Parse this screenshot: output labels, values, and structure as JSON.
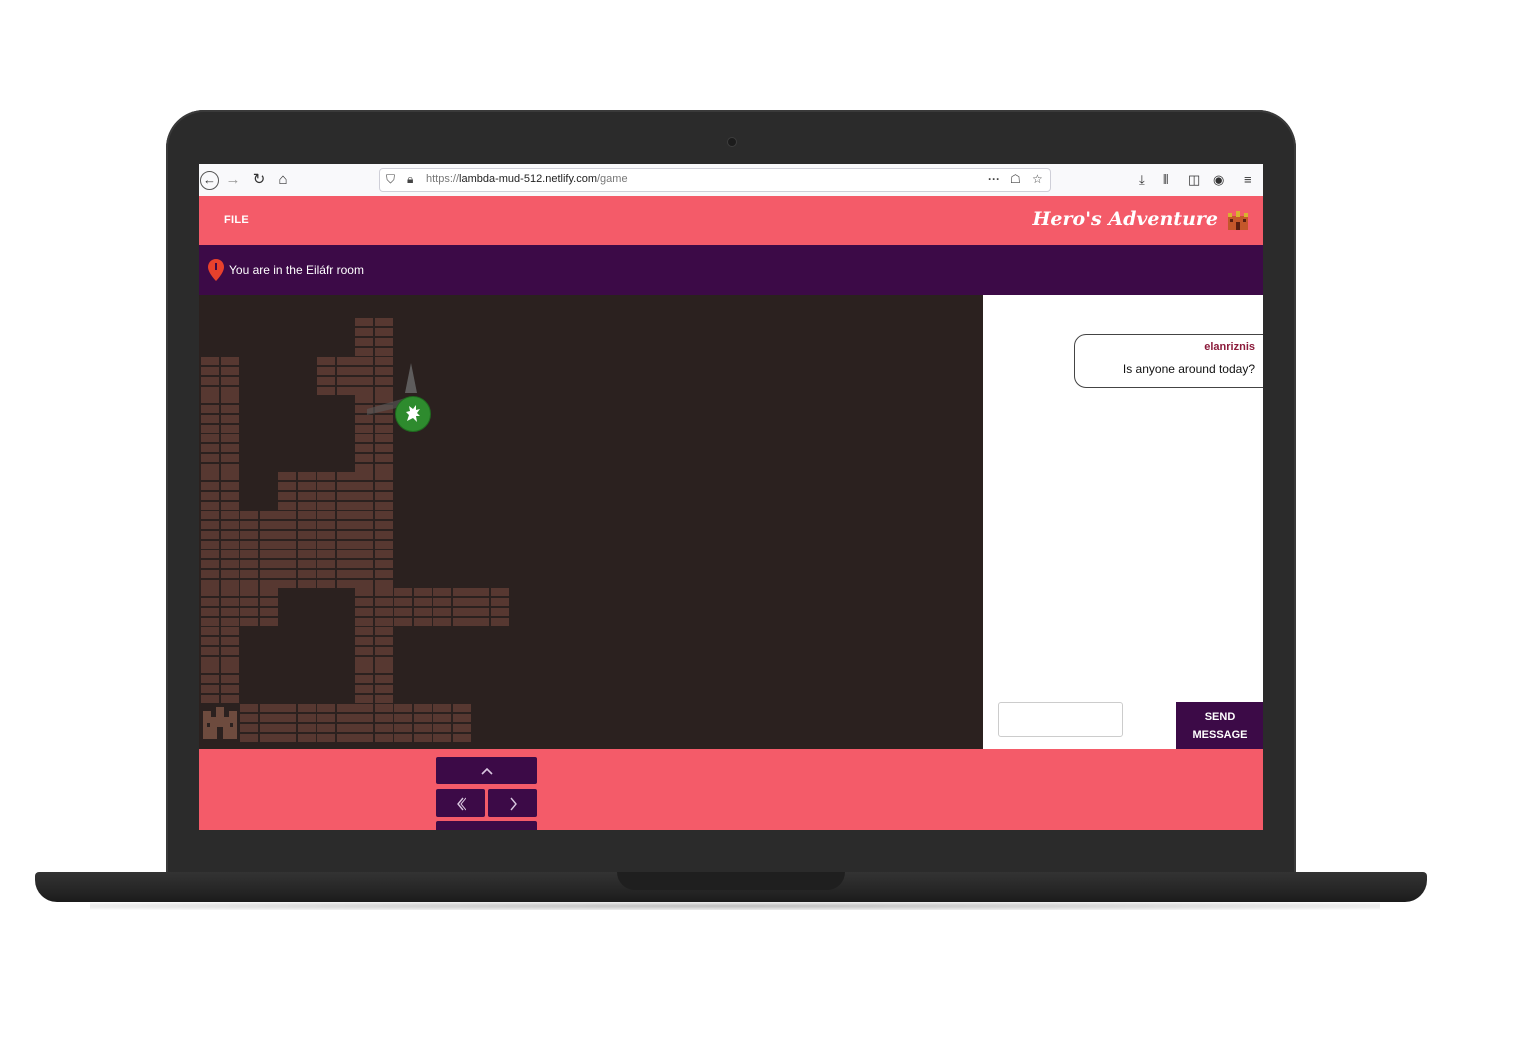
{
  "browser": {
    "url_prefix": "https://",
    "url_host": "lambda-mud-512.netlify.com",
    "url_path": "/game"
  },
  "header": {
    "file_label": "FILE",
    "brand": "Hero's Adventure"
  },
  "room": {
    "text": "You are in the Eiláfr room"
  },
  "chat": {
    "messages": [
      {
        "user": "elanriznis",
        "text": "Is anyone around today?"
      }
    ],
    "input_placeholder": "",
    "send_label_line1": "SEND",
    "send_label_line2": "MESSAGE"
  },
  "controls": {
    "up_icon": "chevron-up-icon",
    "left_icon": "chevron-left-icon",
    "right_icon": "chevron-right-icon",
    "down_icon": "chevron-down-icon"
  },
  "colors": {
    "header": "#f45b69",
    "room_bar": "#3c0a47",
    "map_bg": "#2b211f",
    "brick": "#5a3a32",
    "hero": "#2e8b2e",
    "username": "#8b1a3a"
  }
}
